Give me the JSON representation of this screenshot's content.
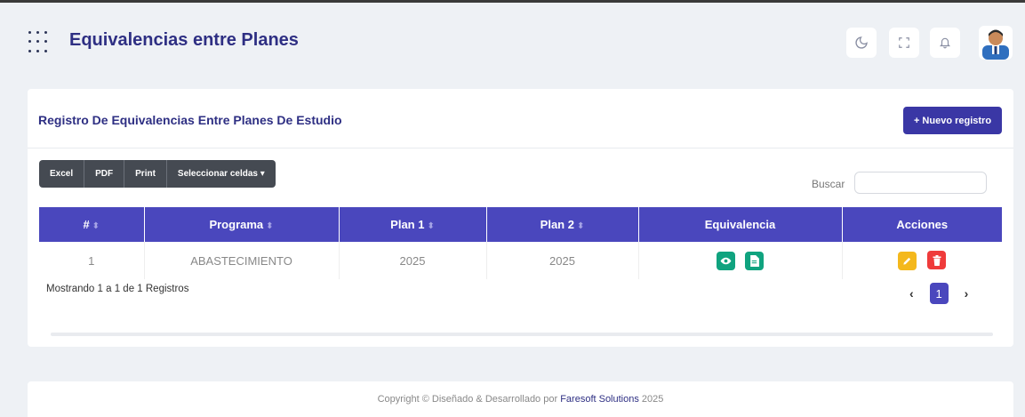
{
  "header": {
    "title": "Equivalencias entre Planes",
    "icons": [
      "grid-icon",
      "moon-icon",
      "fullscreen-icon",
      "bell-icon"
    ]
  },
  "card": {
    "title": "Registro De Equivalencias Entre Planes De Estudio",
    "new_button": "+ Nuevo registro",
    "toolbar": {
      "excel": "Excel",
      "pdf": "PDF",
      "print": "Print",
      "select_cells": "Seleccionar celdas ▾"
    },
    "search_label": "Buscar",
    "search_value": ""
  },
  "table": {
    "headers": [
      "#",
      "Programa",
      "Plan 1",
      "Plan 2",
      "Equivalencia",
      "Acciones"
    ],
    "rows": [
      {
        "num": "1",
        "programa": "ABASTECIMIENTO",
        "plan1": "2025",
        "plan2": "2025"
      }
    ]
  },
  "pagination": {
    "showing": "Mostrando 1 a 1 de 1 Registros",
    "current": "1",
    "prev": "‹",
    "next": "›"
  },
  "footer": {
    "text": "Copyright © Diseñado & Desarrollado por",
    "brand": "Faresoft Solutions",
    "year": "2025"
  },
  "colors": {
    "accent": "#4a47bd",
    "title": "#2e2f83",
    "teal": "#10a37f",
    "yellow": "#f4b81c",
    "red": "#ef3b3b"
  }
}
